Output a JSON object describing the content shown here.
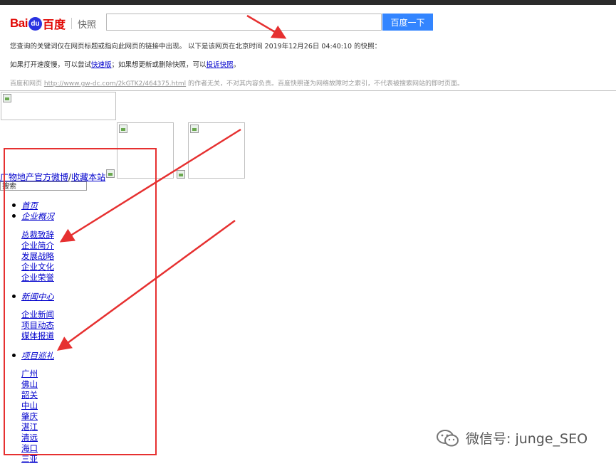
{
  "header": {
    "logo_bai": "Bai",
    "logo_paw": "du",
    "logo_du": "百度",
    "logo_product": "快照",
    "search_button": "百度一下",
    "search_value": ""
  },
  "notice": {
    "line1": "您查询的关键词仅在网页标题或指向此网页的链接中出现。  以下是该网页在北京时间 2019年12月26日 04:40:10 的快照：",
    "line2_pre": "如果打开速度慢，可以尝试",
    "line2_link1": "快速版",
    "line2_mid": "；如果想更新或删除快照，可以",
    "line2_link2": "投诉快照",
    "line2_post": "。",
    "line3_pre": "百度和网页 ",
    "line3_url": "http://www.gw-dc.com/2kGTK2/464375.html",
    "line3_post": " 的作者无关，不对其内容负责。百度快照谨为网络故障时之索引，不代表被搜索网站的即时页面。"
  },
  "page": {
    "site_link": "广物地产官方微博",
    "slash": "/",
    "favorite_link": "收藏本站",
    "search_box": "搜索",
    "nav": [
      {
        "label": "首页",
        "children": []
      },
      {
        "label": "企业概况",
        "children": [
          "总裁致辞",
          "企业简介",
          "发展战略",
          "企业文化",
          "企业荣誉"
        ]
      },
      {
        "label": "新闻中心",
        "children": [
          "企业新闻",
          "项目动态",
          "媒体报道"
        ]
      },
      {
        "label": "项目巡礼",
        "children": [
          "广州",
          "佛山",
          "韶关",
          "中山",
          "肇庆",
          "湛江",
          "清远",
          "海口",
          "三亚"
        ]
      }
    ]
  },
  "watermark": {
    "text": "微信号: junge_SEO",
    "icon": "wechat-icon"
  },
  "colors": {
    "search_button": "#3385ff",
    "logo_red": "#e10602",
    "logo_blue": "#2932e1",
    "annotation_red": "#e63030",
    "link_blue": "#0000cc"
  }
}
